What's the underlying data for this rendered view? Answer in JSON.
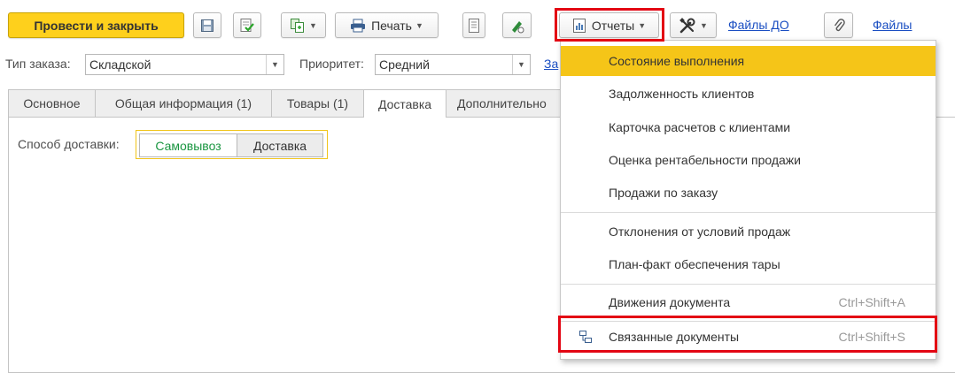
{
  "toolbar": {
    "post_and_close": "Провести и закрыть",
    "print_label": "Печать",
    "reports_label": "Отчеты",
    "files_do_link": "Файлы ДО",
    "files_link": "Файлы"
  },
  "fields": {
    "order_type_label": "Тип заказа:",
    "order_type_value": "Складской",
    "priority_label": "Приоритет:",
    "priority_value": "Средний",
    "truncated_link": "За"
  },
  "tabs": [
    {
      "label": "Основное"
    },
    {
      "label": "Общая информация (1)"
    },
    {
      "label": "Товары (1)"
    },
    {
      "label": "Доставка"
    },
    {
      "label": "Дополнительно"
    }
  ],
  "delivery": {
    "method_label": "Способ доставки:",
    "option_pickup": "Самовывоз",
    "option_delivery": "Доставка"
  },
  "menu": {
    "items": [
      {
        "label": "Состояние выполнения",
        "shortcut": ""
      },
      {
        "label": "Задолженность клиентов",
        "shortcut": ""
      },
      {
        "label": "Карточка расчетов с клиентами",
        "shortcut": ""
      },
      {
        "label": "Оценка рентабельности продажи",
        "shortcut": ""
      },
      {
        "label": "Продажи по заказу",
        "shortcut": ""
      },
      {
        "label": "Отклонения от условий продаж",
        "shortcut": ""
      },
      {
        "label": "План-факт обеспечения тары",
        "shortcut": ""
      },
      {
        "label": "Движения документа",
        "shortcut": "Ctrl+Shift+A"
      },
      {
        "label": "Связанные документы",
        "shortcut": "Ctrl+Shift+S"
      }
    ]
  },
  "colors": {
    "primary_button": "#fed01c",
    "menu_highlight": "#f5c518",
    "link": "#1a4ec2",
    "annotation_red": "#e30613",
    "selected_option_text": "#1a9641"
  }
}
